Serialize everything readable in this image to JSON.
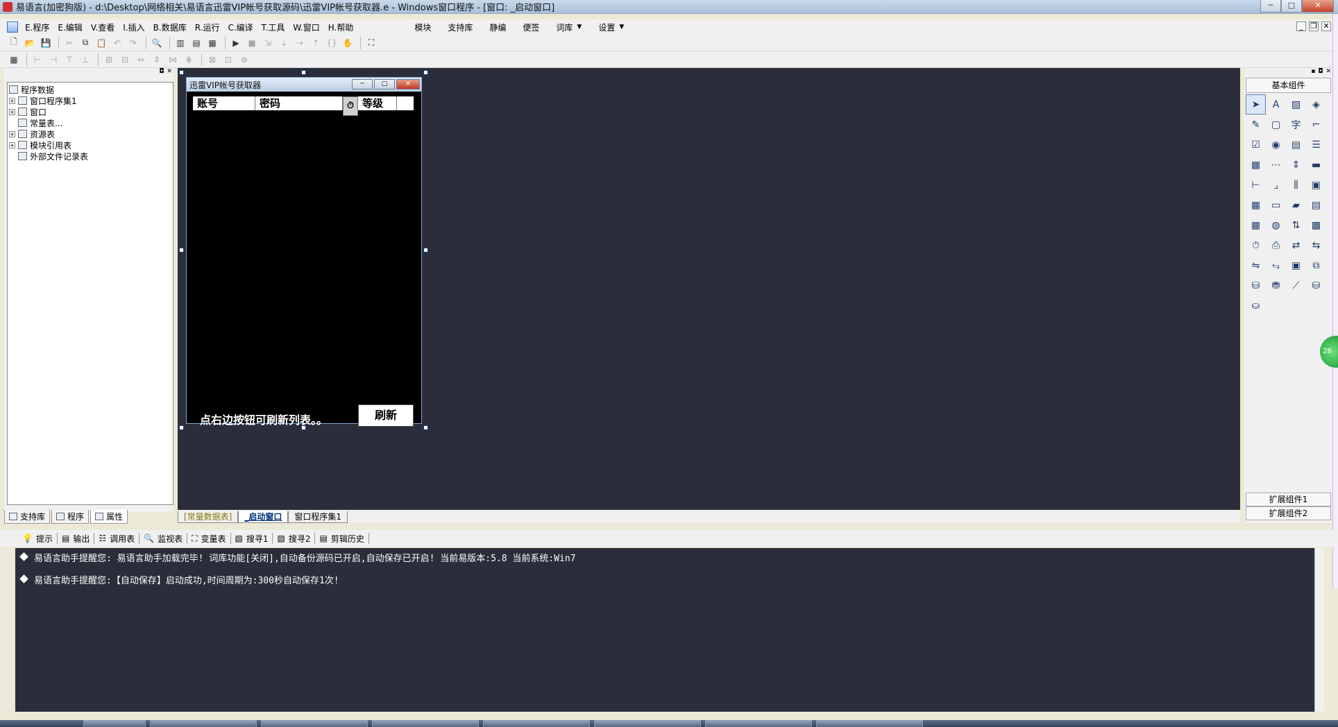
{
  "window": {
    "title": "易语言(加密狗版) - d:\\Desktop\\网络相关\\易语言迅雷VIP帐号获取源码\\迅雷VIP帐号获取器.e - Windows窗口程序 - [窗口: _启动窗口]"
  },
  "menu": {
    "items": [
      "E.程序",
      "E.编辑",
      "V.查看",
      "I.插入",
      "B.数据库",
      "R.运行",
      "C.编译",
      "T.工具",
      "W.窗口",
      "H.帮助"
    ],
    "right_items": [
      "模块",
      "支持库",
      "静编",
      "便签",
      "词库",
      "设置"
    ]
  },
  "left_panel": {
    "tree": {
      "root": "程序数据",
      "items": [
        {
          "label": "窗口程序集1",
          "expandable": true
        },
        {
          "label": "窗口",
          "expandable": true
        },
        {
          "label": "常量表...",
          "expandable": false
        },
        {
          "label": "资源表",
          "expandable": true
        },
        {
          "label": "模块引用表",
          "expandable": true
        },
        {
          "label": "外部文件记录表",
          "expandable": false
        }
      ]
    },
    "tabs": [
      "支持库",
      "程序",
      "属性"
    ]
  },
  "form": {
    "title": "迅雷VIP帐号获取器",
    "columns": [
      "账号",
      "密码",
      "等级"
    ],
    "hint_label": "点右边按钮可刷新列表。。",
    "refresh_button": "刷新"
  },
  "editor_tabs": [
    "[常量数据表]",
    "_启动窗口",
    "窗口程序集1"
  ],
  "right_panel": {
    "title": "基本组件",
    "extensions": [
      "扩展组件1",
      "扩展组件2"
    ]
  },
  "side_badge": "28",
  "output_tabs": [
    "提示",
    "输出",
    "调用表",
    "监视表",
    "变量表",
    "搜寻1",
    "搜寻2",
    "剪辑历史"
  ],
  "output_lines": [
    "易语言助手提醒您:  易语言助手加载完毕! 词库功能[关闭],自动备份源码已开启,自动保存已开启! 当前易版本:5.8  当前系统:Win7",
    "易语言助手提醒您:【自动保存】启动成功,时间周期为:300秒自动保存1次!"
  ]
}
